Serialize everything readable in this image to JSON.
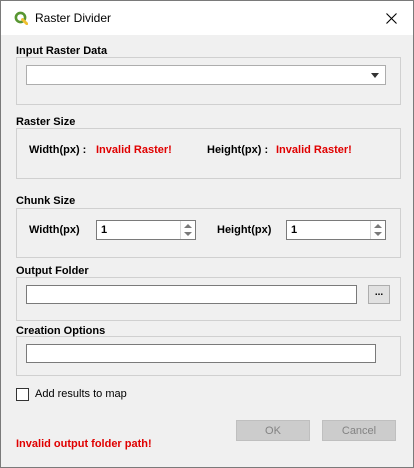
{
  "window": {
    "title": "Raster Divider"
  },
  "input_raster": {
    "label": "Input Raster Data",
    "selected": ""
  },
  "raster_size": {
    "label": "Raster Size",
    "width_label": "Width(px) :",
    "width_value": "Invalid Raster!",
    "height_label": "Height(px) :",
    "height_value": "Invalid Raster!"
  },
  "chunk_size": {
    "label": "Chunk Size",
    "width_label": "Width(px)",
    "width_value": "1",
    "height_label": "Height(px)",
    "height_value": "1"
  },
  "output_folder": {
    "label": "Output Folder",
    "value": "",
    "browse_label": "..."
  },
  "creation_options": {
    "label": "Creation Options",
    "value": ""
  },
  "add_results": {
    "label": "Add results to map",
    "checked": false
  },
  "buttons": {
    "ok": "OK",
    "cancel": "Cancel"
  },
  "status": {
    "error": "Invalid output folder path!"
  },
  "colors": {
    "error": "#e00000",
    "icon_green": "#589632",
    "icon_yellow": "#f0c030"
  },
  "icons": {
    "app": "qgis-icon",
    "close": "close-icon"
  }
}
